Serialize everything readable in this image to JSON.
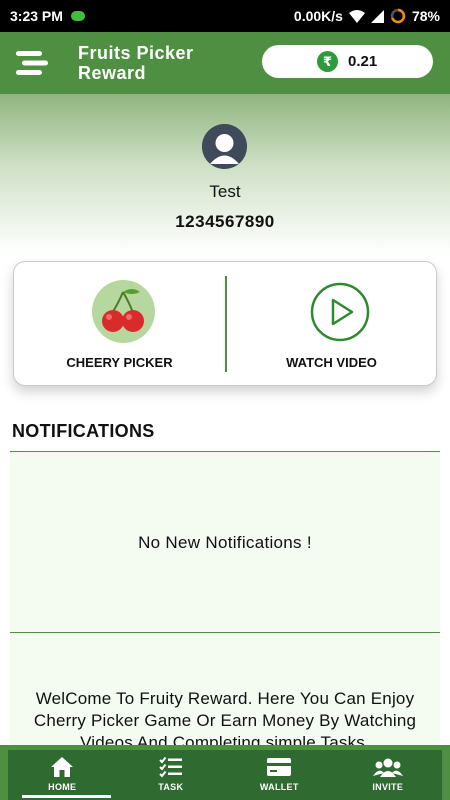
{
  "status_bar": {
    "time": "3:23 PM",
    "network_speed": "0.00K/s",
    "battery": "78%"
  },
  "app_bar": {
    "title_line1": "Fruits Picker",
    "title_line2": "Reward",
    "currency_symbol": "₹",
    "balance": "0.21"
  },
  "profile": {
    "name": "Test",
    "phone": "1234567890"
  },
  "actions": {
    "cherry_label": "CHEERY PICKER",
    "video_label": "WATCH VIDEO"
  },
  "notifications": {
    "heading": "NOTIFICATIONS",
    "empty_text": "No New Notifications !",
    "welcome_text": "WelCome To Fruity Reward. Here You Can Enjoy Cherry Picker Game Or Earn Money By Watching Videos And Completing simple Tasks."
  },
  "bottom_nav": {
    "items": [
      {
        "label": "HOME",
        "icon": "home-icon",
        "active": true
      },
      {
        "label": "TASK",
        "icon": "task-list-icon",
        "active": false
      },
      {
        "label": "WALLET",
        "icon": "wallet-icon",
        "active": false
      },
      {
        "label": "INVITE",
        "icon": "group-icon",
        "active": false
      }
    ]
  },
  "colors": {
    "primary": "#4f8f41",
    "nav_dark": "#2f6a31",
    "rupee_badge": "#2e9a3a",
    "cherry_bg": "#b6d79e"
  }
}
